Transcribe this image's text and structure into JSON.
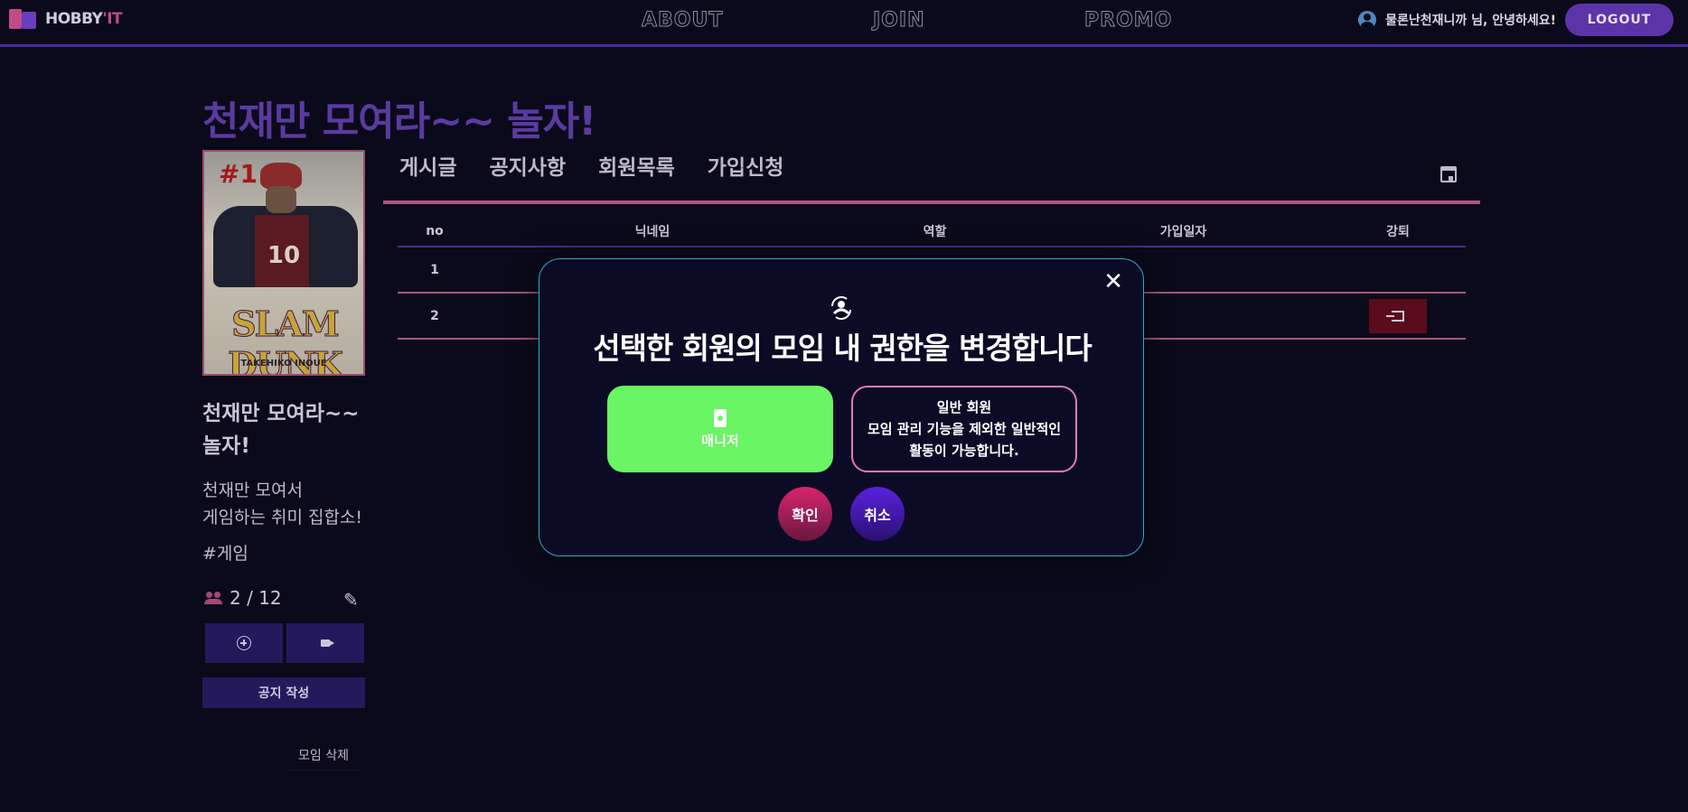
{
  "header": {
    "logo_text": "HOBBY",
    "logo_tick": "'IT",
    "nav": [
      "ABOUT",
      "JOIN",
      "PROMO"
    ],
    "greeting": "물론난천재니까 님, 안녕하세요!",
    "logout_label": "LOGOUT"
  },
  "group": {
    "title": "천재만 모여라~~ 놀자!",
    "cover": {
      "badge": "#1",
      "jersey_number": "10",
      "title_art": "SLAM DUNK",
      "author": "TAKEHIKO INOUE"
    },
    "name": "천재만 모여라~~ 놀자!",
    "description_line1": "천재만 모여서",
    "description_line2": "게임하는 취미 집합소!",
    "tag": "#게임",
    "members": "2 / 12",
    "notice_button": "공지 작성",
    "delete_link": "모임 삭제"
  },
  "tabs": [
    "게시글",
    "공지사항",
    "회원목록",
    "가입신청"
  ],
  "table": {
    "headers": [
      "no",
      "닉네임",
      "역할",
      "가입일자",
      "강퇴"
    ],
    "rows": [
      {
        "no": "1",
        "date": "-02-17"
      },
      {
        "no": "2",
        "date": "-02-17"
      }
    ]
  },
  "modal": {
    "title": "선택한 회원의 모임 내 권한을 변경합니다",
    "manager_label": "매니저",
    "member_line1": "일반 회원",
    "member_line2": "모임 관리 기능을 제외한 일반적인",
    "member_line3": "활동이 가능합니다.",
    "confirm_label": "확인",
    "cancel_label": "취소"
  },
  "colors": {
    "accent_purple": "#5b3aa0",
    "accent_pink": "#a8557a",
    "manager_green": "#6af564",
    "modal_border": "#2fa8c8"
  }
}
